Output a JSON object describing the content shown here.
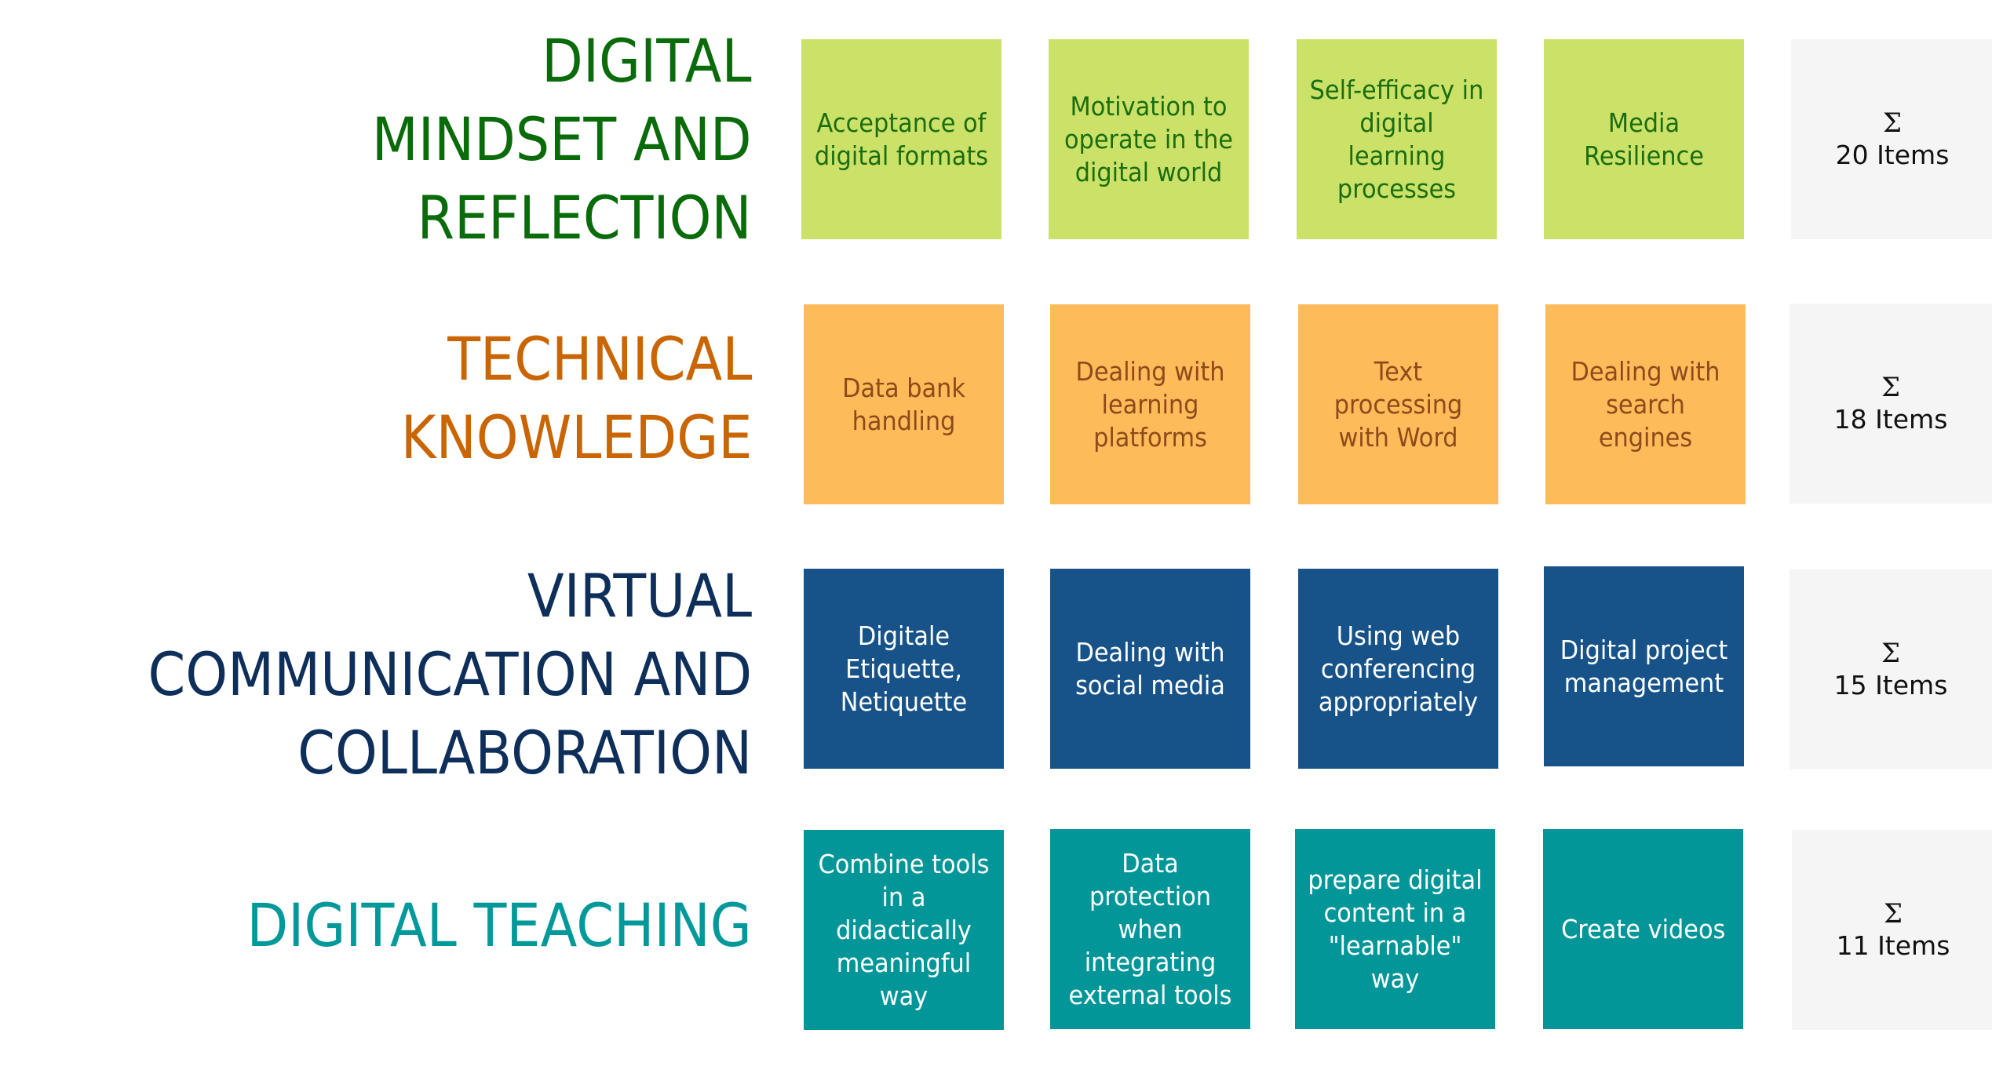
{
  "rows": [
    {
      "heading_lines": [
        "DIGITAL",
        "MINDSET AND",
        "REFLECTION"
      ],
      "heading_color": "#0a6b0a",
      "box_color": "#cbe168",
      "text_color": "#1a6e10",
      "items": [
        "Acceptance of digital formats",
        "Motivation to operate in the digital world",
        "Self-efficacy in digital learning processes",
        "Media Resilience"
      ],
      "sum_symbol": "Σ",
      "sum_label": "20 Items"
    },
    {
      "heading_lines": [
        "TECHNICAL",
        "KNOWLEDGE"
      ],
      "heading_color": "#c96503",
      "box_color": "#fdbb59",
      "text_color": "#8e4a1b",
      "items": [
        "Data bank handling",
        "Dealing with learning platforms",
        "Text processing with Word",
        "Dealing with search engines"
      ],
      "sum_symbol": "Σ",
      "sum_label": "18 Items"
    },
    {
      "heading_lines": [
        "VIRTUAL",
        "COMMUNICATION AND",
        "COLLABORATION"
      ],
      "heading_color": "#0f2f5b",
      "box_color": "#175389",
      "text_color": "#ffffff",
      "items": [
        "Digitale Etiquette, Netiquette",
        "Dealing with social media",
        "Using web conferencing appropriately",
        "Digital project management"
      ],
      "sum_symbol": "Σ",
      "sum_label": "15 Items"
    },
    {
      "heading_lines": [
        "DIGITAL TEACHING"
      ],
      "heading_color": "#03999a",
      "box_color": "#039699",
      "text_color": "#ffffff",
      "items": [
        "Combine tools in a didactically meaningful way",
        "Data protection when integrating external tools",
        "prepare digital content in a \"learnable\" way",
        "Create videos"
      ],
      "sum_symbol": "Σ",
      "sum_label": "11 Items"
    }
  ]
}
